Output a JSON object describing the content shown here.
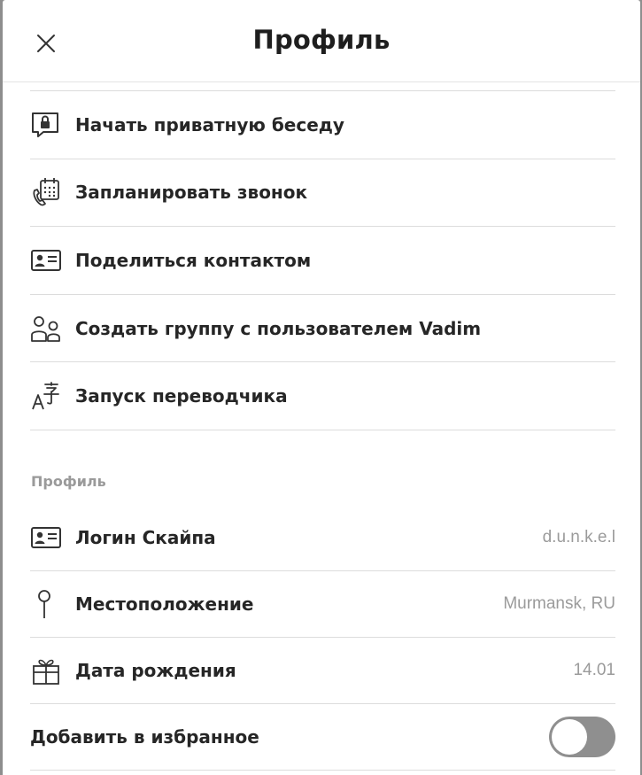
{
  "header": {
    "title": "Профиль"
  },
  "actions": [
    {
      "label": "Начать приватную беседу",
      "icon": "private-chat-lock-icon"
    },
    {
      "label": "Запланировать звонок",
      "icon": "schedule-call-icon"
    },
    {
      "label": "Поделиться контактом",
      "icon": "contact-card-icon"
    },
    {
      "label": "Создать группу с пользователем Vadim",
      "icon": "group-people-icon"
    },
    {
      "label": "Запуск переводчика",
      "icon": "translator-icon"
    }
  ],
  "profile_section": {
    "heading": "Профиль",
    "items": [
      {
        "label": "Логин Скайпа",
        "value": "d.u.n.k.e.l",
        "icon": "contact-card-icon"
      },
      {
        "label": "Местоположение",
        "value": "Murmansk, RU",
        "icon": "location-pin-icon"
      },
      {
        "label": "Дата рождения",
        "value": "14.01",
        "icon": "gift-icon"
      }
    ]
  },
  "favorites": {
    "label": "Добавить в избранное",
    "enabled": false
  },
  "colors": {
    "accent_text": "#262626",
    "muted_text": "#9b9b9b",
    "toggle_off": "#8f8f8f"
  }
}
